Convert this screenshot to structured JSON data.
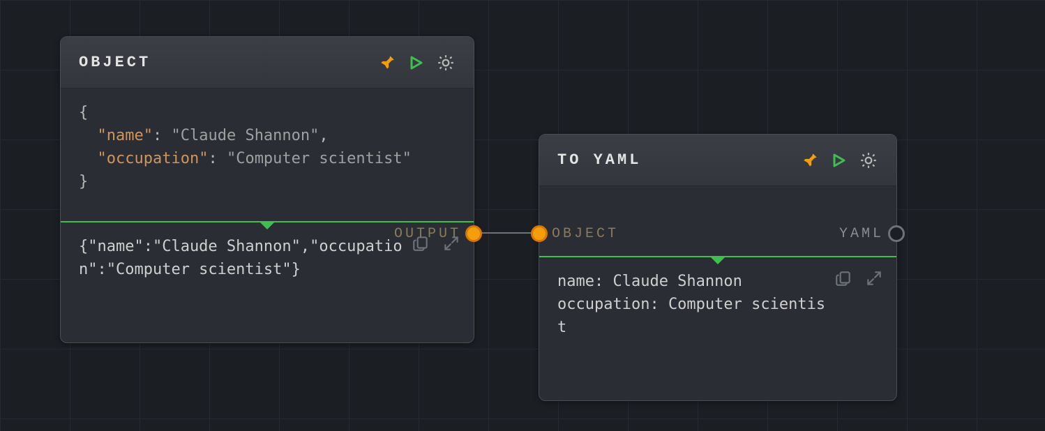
{
  "nodes": {
    "object": {
      "title": "OBJECT",
      "code_line1_brace_open": "{",
      "code_line2_key": "\"name\"",
      "code_line2_colon": ": ",
      "code_line2_val": "\"Claude Shannon\"",
      "code_line2_comma": ",",
      "code_line3_key": "\"occupation\"",
      "code_line3_colon": ": ",
      "code_line3_val": "\"Computer scientist\"",
      "code_line4_brace_close": "}",
      "output_text": "{\"name\":\"Claude Shannon\",\"occupation\":\"Computer scientist\"}",
      "port_out_label": "OUTPUT"
    },
    "toyaml": {
      "title": "TO YAML",
      "output_text": "name: Claude Shannon\noccupation: Computer scientist",
      "port_in_label": "OBJECT",
      "port_out_label": "YAML"
    }
  },
  "colors": {
    "accent_orange": "#f59e0b",
    "accent_green": "#3fbf4f",
    "bg": "#1b1e23",
    "node_bg": "#2a2d33"
  }
}
